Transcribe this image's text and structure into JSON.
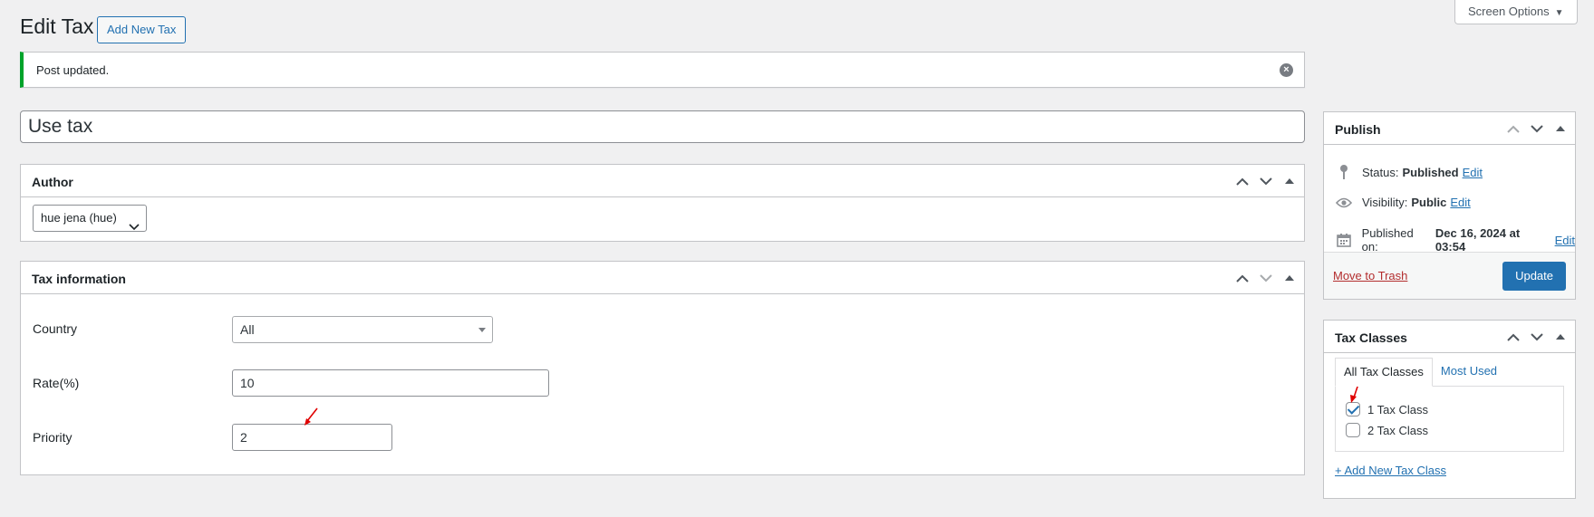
{
  "header": {
    "title": "Edit Tax",
    "add_new_label": "Add New Tax",
    "screen_options_label": "Screen Options"
  },
  "notice": {
    "text": "Post updated."
  },
  "post_title": {
    "value": "Use tax"
  },
  "author": {
    "title": "Author",
    "selected": "hue jena (hue)"
  },
  "tax_info": {
    "title": "Tax information",
    "country_label": "Country",
    "country_value": "All",
    "rate_label": "Rate(%)",
    "rate_value": "10",
    "priority_label": "Priority",
    "priority_value": "2"
  },
  "publish": {
    "title": "Publish",
    "status_label": "Status:",
    "status_value": "Published",
    "visibility_label": "Visibility:",
    "visibility_value": "Public",
    "published_label": "Published on:",
    "published_value": "Dec 16, 2024 at 03:54",
    "edit_label": "Edit",
    "trash_label": "Move to Trash",
    "update_label": "Update"
  },
  "tax_classes": {
    "title": "Tax Classes",
    "tabs": [
      "All Tax Classes",
      "Most Used"
    ],
    "items": [
      {
        "label": "1 Tax Class",
        "checked": true
      },
      {
        "label": "2 Tax Class",
        "checked": false
      }
    ],
    "add_new_label": "+ Add New Tax Class"
  },
  "colors": {
    "accent": "#2271b1",
    "success_border": "#00a32a",
    "trash": "#b32d2e",
    "annotation": "#e00000"
  }
}
